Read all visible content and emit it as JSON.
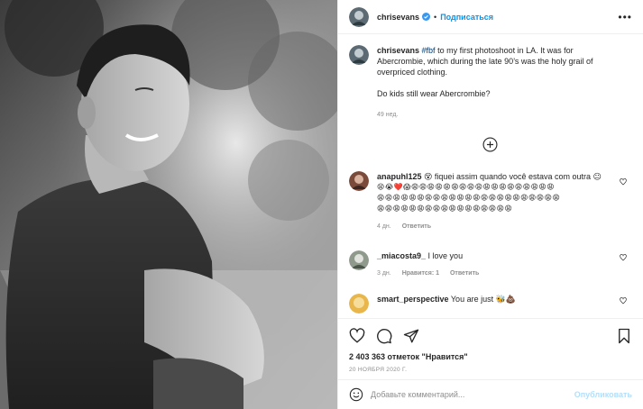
{
  "post": {
    "author": "chrisevans",
    "follow_label": "Подписаться",
    "separator": "•",
    "more_icon": "more-horizontal-icon",
    "verified_icon": "verified-badge-icon"
  },
  "caption": {
    "author": "chrisevans",
    "hashtag": "#fbf",
    "text_rest": " to my first photoshoot in LA. It was for Abercrombie, which during the late 90’s was the holy grail of overpriced clothing.",
    "text_second": "Do kids still wear Abercrombie?",
    "time": "49 нед."
  },
  "load_more_icon": "plus-circle-icon",
  "comments": [
    {
      "author": "anapuhl125",
      "text": " fiquei assim quando você estava com outra ",
      "emoji_line1": "😫😭❤️😱😩😩😩😩😩😩😩😩😩😩😩😩😩😩😩😩😩😩",
      "emoji_line2": "😩😩😩😩😩😩😩😩😩😩😩😩😩😩😩😩😩😩😩😩😩😩😩",
      "emoji_line3": "😩😩😩😩😩😩😩😩😩😩😩😩😩😩😩😩😩",
      "time": "4 дн.",
      "reply_label": "Ответить"
    },
    {
      "author": "_miacosta9_",
      "text": " I love you",
      "time": "3 дн.",
      "likes_label": "Нравится: 1",
      "reply_label": "Ответить"
    },
    {
      "author": "smart_perspective",
      "text": " You are just 🐝💩"
    }
  ],
  "actions": {
    "like_icon": "heart-icon",
    "comment_icon": "comment-icon",
    "share_icon": "share-icon",
    "save_icon": "bookmark-icon"
  },
  "likes_text": "2 403 363 отметок \"Нравится\"",
  "date": "20 НОЯБРЯ 2020 Г.",
  "add_comment": {
    "placeholder": "Добавьте комментарий...",
    "publish_label": "Опубликовать",
    "emoji_icon": "smiley-icon"
  },
  "colors": {
    "accent": "#0095f6",
    "verified": "#3897f0",
    "muted": "#8e8e8e",
    "publish_disabled": "#b2dffc"
  }
}
